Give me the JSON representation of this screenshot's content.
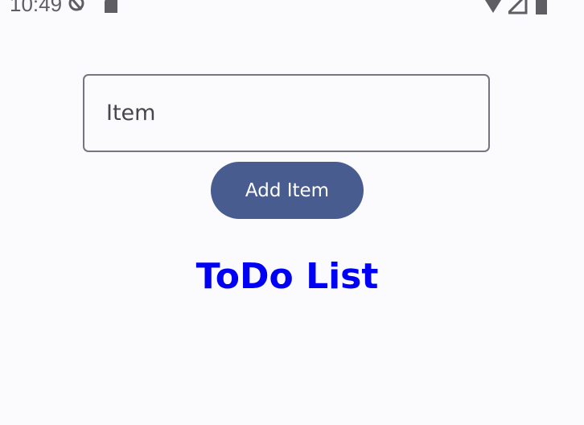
{
  "status_bar": {
    "time": "10:49",
    "icons": [
      "do-not-disturb-icon",
      "sd-card-icon",
      "wifi-icon",
      "cell-signal-icon",
      "battery-icon"
    ]
  },
  "form": {
    "item_placeholder": "Item",
    "item_value": ""
  },
  "actions": {
    "add_label": "Add Item"
  },
  "list": {
    "title": "ToDo List"
  },
  "colors": {
    "background": "#fbfbfd",
    "accent_button": "#485c90",
    "title": "#0000f5",
    "field_border": "#74777f"
  }
}
